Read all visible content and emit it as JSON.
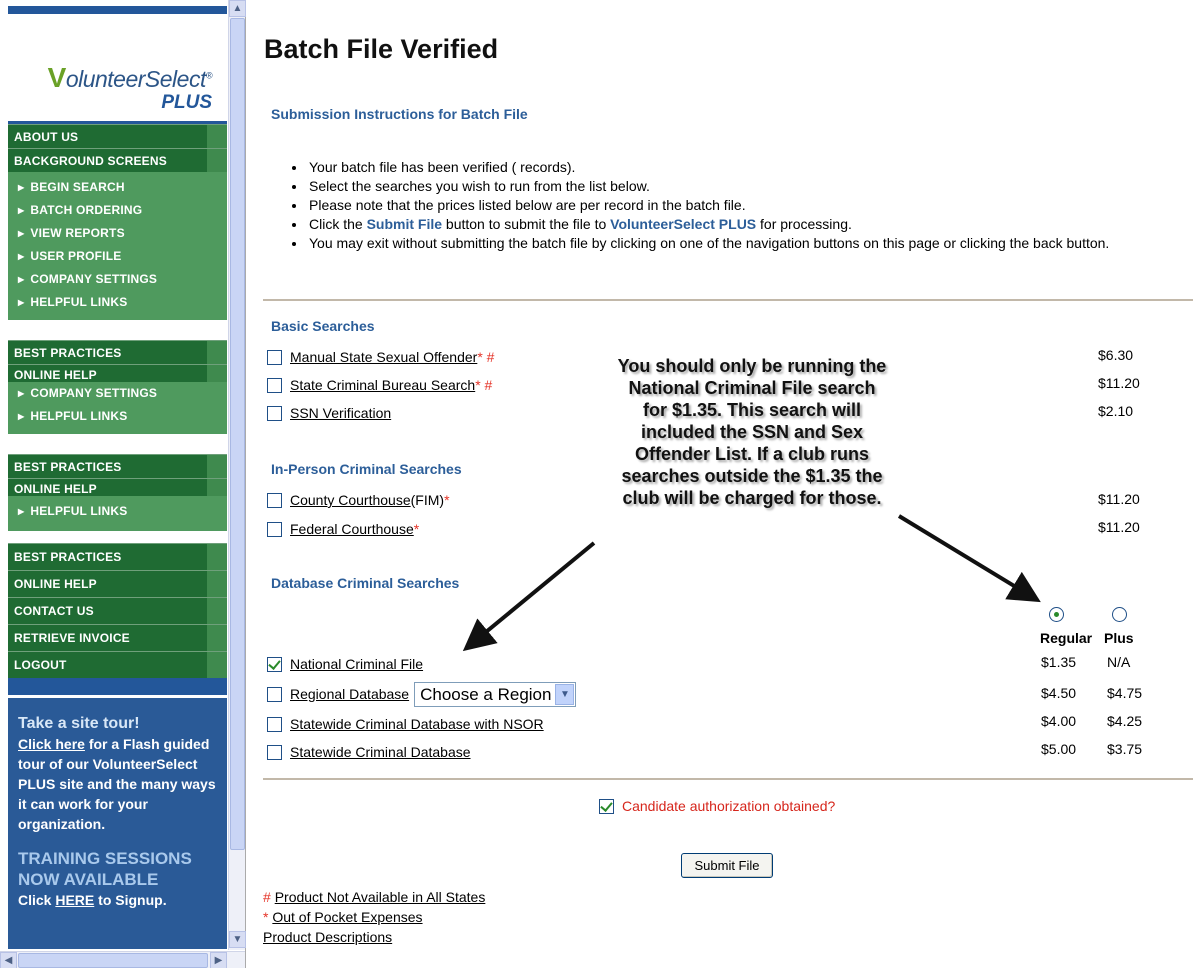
{
  "sidebar": {
    "logo": {
      "word": "olunteerSelect",
      "first_letter": "V",
      "trademark": "®",
      "plus": "PLUS"
    },
    "nav_primary": [
      "ABOUT US",
      "BACKGROUND SCREENS"
    ],
    "nav_sub_main": [
      "BEGIN SEARCH",
      "BATCH ORDERING",
      "VIEW REPORTS",
      "USER PROFILE",
      "COMPANY SETTINGS",
      "HELPFUL LINKS"
    ],
    "best_practices": "BEST PRACTICES",
    "online_help": "ONLINE HELP",
    "dup_sub_1": [
      "COMPANY SETTINGS",
      "HELPFUL LINKS"
    ],
    "dup_sub_2": [
      "HELPFUL LINKS"
    ],
    "bottom_nav": [
      "BEST PRACTICES",
      "ONLINE HELP",
      "CONTACT US",
      "RETRIEVE INVOICE",
      "LOGOUT"
    ],
    "tour": {
      "title": "Take a site tour!",
      "link": "Click here",
      "text": "for a Flash guided tour of our VolunteerSelect PLUS site and the many ways it can work for your organization.",
      "training_title": "TRAINING SESSIONS NOW AVAILABLE",
      "signup_pre": "Click",
      "signup_link": "HERE",
      "signup_post": "to Signup."
    }
  },
  "main": {
    "title": "Batch File Verified",
    "instructions_heading": "Submission Instructions for Batch File",
    "instructions": {
      "i1": "Your batch file has been verified (      records).",
      "i2": "Select the searches you wish to run from the list below.",
      "i3": "Please note that the prices listed below are per record in the batch file.",
      "i4_pre": "Click the",
      "i4_link1": "Submit File",
      "i4_mid": "button to submit the file to",
      "i4_link2": "VolunteerSelect PLUS",
      "i4_post": "for processing.",
      "i5": "You may exit without submitting the batch file by clicking on one of the navigation buttons on this page or clicking the back button."
    },
    "basic_heading": "Basic Searches",
    "basic": [
      {
        "label": "Manual State Sexual Offender",
        "mark": "* #",
        "price": "$6.30"
      },
      {
        "label": "State Criminal Bureau Search",
        "mark": "* #",
        "price": "$11.20"
      },
      {
        "label": "SSN Verification",
        "mark": "",
        "price": "$2.10"
      }
    ],
    "inperson_heading": "In-Person Criminal Searches",
    "inperson": [
      {
        "label": "County Courthouse",
        "extra": " (FIM)",
        "mark": "*",
        "price": "$11.20"
      },
      {
        "label": "Federal Courthouse",
        "extra": "",
        "mark": "*",
        "price": "$11.20"
      }
    ],
    "database_heading": "Database Criminal Searches",
    "col_regular": "Regular",
    "col_plus": "Plus",
    "database": [
      {
        "label": "National Criminal File",
        "regular": "$1.35",
        "plus": "N/A",
        "checked": true
      },
      {
        "label": "Regional Database",
        "regular": "$4.50",
        "plus": "$4.75",
        "checked": false
      },
      {
        "label": "Statewide Criminal Database with NSOR",
        "regular": "$4.00",
        "plus": "$4.25",
        "checked": false
      },
      {
        "label": "Statewide Criminal Database",
        "regular": "$5.00",
        "plus": "$3.75",
        "checked": false
      }
    ],
    "region_select": "Choose a Region",
    "authorization": "Candidate authorization obtained?",
    "submit": "Submit File",
    "footnote1_mark": "#",
    "footnote1": "Product Not Available in All States",
    "footnote2_mark": "*",
    "footnote2": "Out of Pocket Expenses",
    "footnote3": "Product Descriptions"
  },
  "callout": {
    "line1": "You should only be running the",
    "line2": "National Criminal File search",
    "line3": "for $1.35.  This search will",
    "line4": "included the SSN and Sex",
    "line5": "Offender List.  If a club runs",
    "line6": "searches outside the $1.35 the",
    "line7": "club will be charged for those."
  }
}
